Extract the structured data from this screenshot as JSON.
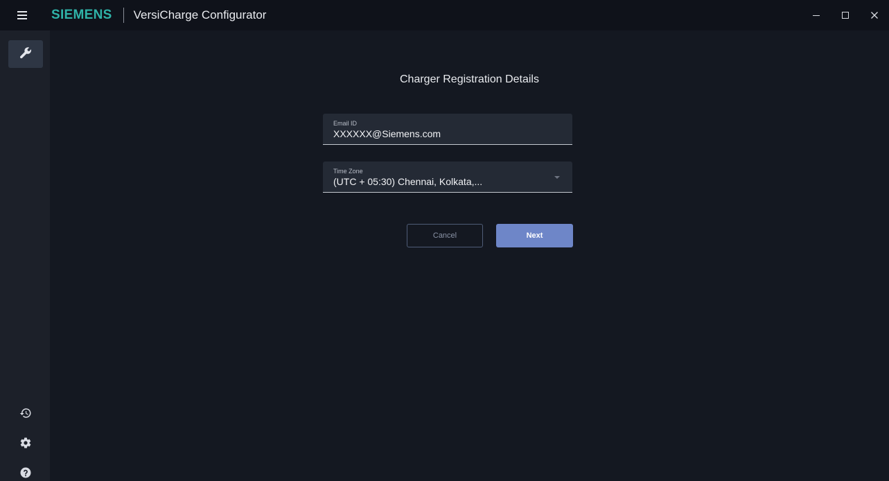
{
  "titlebar": {
    "brand": "SIEMENS",
    "app_title": "VersiCharge Configurator",
    "menu_icon": "hamburger-menu-icon",
    "window_controls": [
      "minimize-icon",
      "maximize-icon",
      "close-icon"
    ]
  },
  "sidebar": {
    "items": [
      {
        "icon": "wrench-icon",
        "active": true
      },
      {
        "icon": "history-icon",
        "active": false
      },
      {
        "icon": "gear-icon",
        "active": false
      },
      {
        "icon": "help-icon",
        "active": false
      }
    ]
  },
  "form": {
    "title": "Charger Registration Details",
    "email": {
      "label": "Email ID",
      "value": "XXXXXX@Siemens.com"
    },
    "timezone": {
      "label": "Time Zone",
      "value": "(UTC + 05:30) Chennai, Kolkata,..."
    },
    "cancel_label": "Cancel",
    "next_label": "Next"
  },
  "colors": {
    "brand": "#2fb3a8",
    "primary_button": "#6e86c8",
    "background": "#141821",
    "sidebar": "#1c2029"
  }
}
